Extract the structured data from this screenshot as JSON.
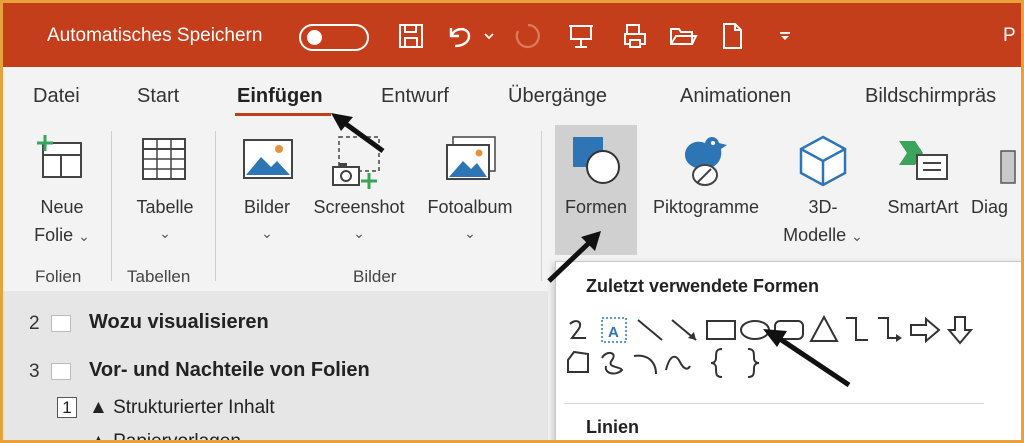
{
  "titlebar": {
    "autosave_label": "Automatisches Speichern",
    "right_text": "P"
  },
  "tabs": [
    {
      "label": "Datei"
    },
    {
      "label": "Start"
    },
    {
      "label": "Einfügen"
    },
    {
      "label": "Entwurf"
    },
    {
      "label": "Übergänge"
    },
    {
      "label": "Animationen"
    },
    {
      "label": "Bildschirmpräs"
    }
  ],
  "ribbon": {
    "neue_folie_1": "Neue",
    "neue_folie_2": "Folie",
    "tabelle": "Tabelle",
    "bilder": "Bilder",
    "screenshot": "Screenshot",
    "fotoalbum": "Fotoalbum",
    "formen": "Formen",
    "piktogramme": "Piktogramme",
    "modelle_1": "3D-",
    "modelle_2": "Modelle",
    "smartart": "SmartArt",
    "diagramm": "Diag",
    "groups": {
      "folien": "Folien",
      "tabellen": "Tabellen",
      "bilder": "Bilder"
    }
  },
  "slides": [
    {
      "num": "2",
      "title": "Wozu visualisieren"
    },
    {
      "num": "3",
      "title": "Vor- und Nachteile von Folien"
    }
  ],
  "bullets": [
    {
      "num": "1",
      "text": "▲ Strukturierter Inhalt"
    },
    {
      "text": "▲ Papiervorlagen"
    }
  ],
  "shapes_panel": {
    "recent_header": "Zuletzt verwendete Formen",
    "lines_header": "Linien"
  },
  "colors": {
    "accent": "#c43e1c",
    "border": "#e9a13b",
    "icon_blue": "#2e75b6"
  }
}
